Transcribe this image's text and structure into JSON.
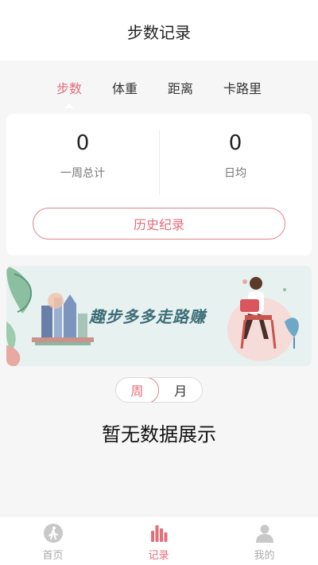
{
  "header": {
    "title": "步数记录"
  },
  "tabs": [
    {
      "label": "步数",
      "active": true
    },
    {
      "label": "体重",
      "active": false
    },
    {
      "label": "距离",
      "active": false
    },
    {
      "label": "卡路里",
      "active": false
    }
  ],
  "stats": {
    "total_value": "0",
    "total_label": "一周总计",
    "avg_value": "0",
    "avg_label": "日均",
    "history_button": "历史纪录"
  },
  "banner": {
    "text": "趣步多多走路赚"
  },
  "period": {
    "week": "周",
    "month": "月",
    "selected": "week"
  },
  "empty_message": "暂无数据展示",
  "bottom_nav": [
    {
      "label": "首页",
      "icon": "walker-icon",
      "active": false
    },
    {
      "label": "记录",
      "icon": "bar-chart-icon",
      "active": true
    },
    {
      "label": "我的",
      "icon": "person-icon",
      "active": false
    }
  ],
  "colors": {
    "accent": "#e46d78",
    "background": "#f6f6f6",
    "inactive": "#aaaaaa"
  }
}
